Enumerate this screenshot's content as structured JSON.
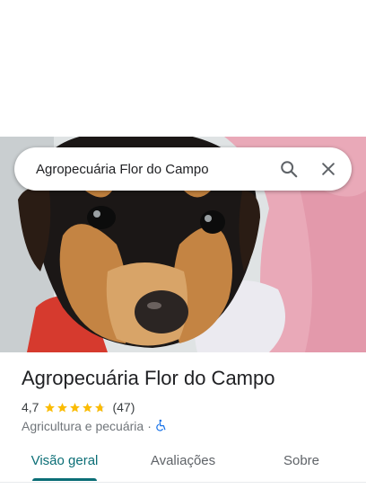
{
  "search": {
    "query": "Agropecuária Flor do Campo"
  },
  "place": {
    "name": "Agropecuária Flor do Campo",
    "rating": "4,7",
    "rating_value": 4.7,
    "reviews": "(47)",
    "category": "Agricultura e pecuária",
    "separator": "·",
    "accessibility": "wheelchair-accessible-icon"
  },
  "tabs": [
    {
      "label": "Visão geral",
      "active": true
    },
    {
      "label": "Avaliações",
      "active": false
    },
    {
      "label": "Sobre",
      "active": false
    }
  ],
  "colors": {
    "accent": "#0b6e76",
    "star": "#fbbc04",
    "accessibility": "#1a73e8",
    "text_primary": "#202124",
    "text_secondary": "#70757a"
  },
  "hero_image": "puppy-photo"
}
